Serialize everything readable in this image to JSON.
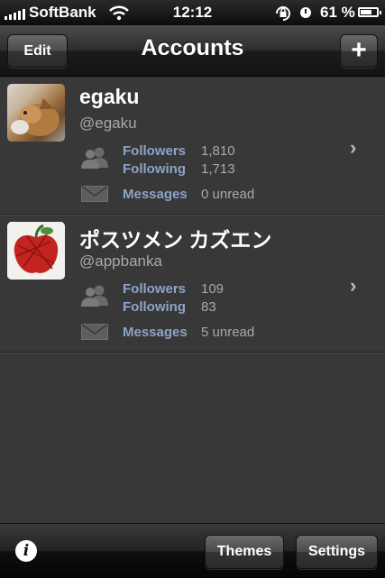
{
  "status_bar": {
    "carrier": "SoftBank",
    "time": "12:12",
    "battery_percent": "61 %",
    "icons": [
      "signal-icon",
      "wifi-icon",
      "rotation-lock-icon",
      "alarm-icon",
      "battery-icon"
    ]
  },
  "nav": {
    "title": "Accounts",
    "edit_label": "Edit",
    "add_label": "+"
  },
  "accounts": [
    {
      "name": "egaku",
      "handle": "@egaku",
      "followers_label": "Followers",
      "followers": "1,810",
      "following_label": "Following",
      "following": "1,713",
      "messages_label": "Messages",
      "messages": "0 unread"
    },
    {
      "name": "ポスツメン カズエン",
      "handle": "@appbanka",
      "followers_label": "Followers",
      "followers": "109",
      "following_label": "Following",
      "following": "83",
      "messages_label": "Messages",
      "messages": "5 unread"
    }
  ],
  "bottom_bar": {
    "info_label": "i",
    "themes_label": "Themes",
    "settings_label": "Settings"
  },
  "colors": {
    "background": "#383838",
    "stat_label": "#8da3c8",
    "stat_value": "#a9a9a9"
  }
}
